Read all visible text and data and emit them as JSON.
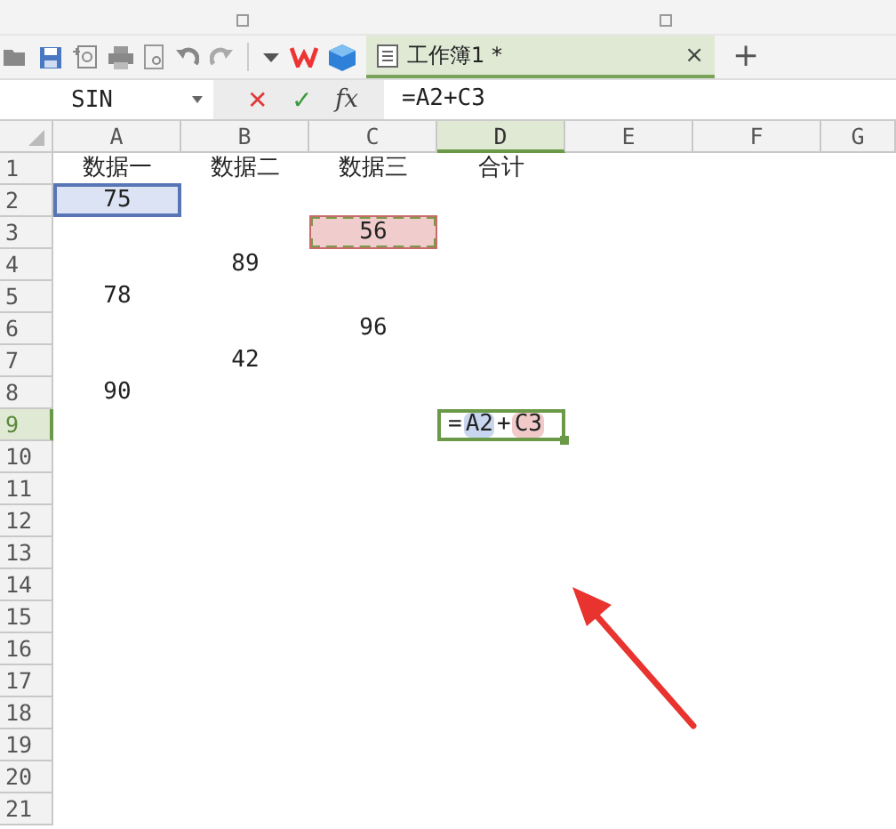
{
  "toolbar": {
    "tab": {
      "title": "工作簿1 *",
      "selected": true,
      "close": "×",
      "new": "+"
    }
  },
  "formula_bar": {
    "name_box": "SIN",
    "cancel": "✕",
    "confirm": "✓",
    "fx": "fx",
    "formula": "=A2+C3"
  },
  "columns": [
    {
      "label": "A",
      "selected": false
    },
    {
      "label": "B",
      "selected": false
    },
    {
      "label": "C",
      "selected": false
    },
    {
      "label": "D",
      "selected": true
    },
    {
      "label": "E",
      "selected": false
    },
    {
      "label": "F",
      "selected": false
    },
    {
      "label": "G",
      "selected": false
    }
  ],
  "rows": [
    {
      "number": "1",
      "selected": false,
      "cells": [
        {
          "text": "数据一"
        },
        {
          "text": "数据二"
        },
        {
          "text": "数据三"
        },
        {
          "text": "合计"
        },
        null,
        null,
        null
      ]
    },
    {
      "number": "2",
      "selected": false,
      "cells": [
        {
          "text": "75",
          "kind": "solid",
          "color": "#dbe3f4"
        },
        null,
        null,
        null,
        null,
        null,
        null
      ]
    },
    {
      "number": "3",
      "selected": false,
      "cells": [
        null,
        null,
        {
          "text": "56",
          "kind": "dashed",
          "color": "#f0cccc"
        },
        null,
        null,
        null,
        null
      ]
    },
    {
      "number": "4",
      "selected": false,
      "cells": [
        null,
        {
          "text": "89"
        },
        null,
        null,
        null,
        null,
        null
      ]
    },
    {
      "number": "5",
      "selected": false,
      "cells": [
        {
          "text": "78"
        },
        null,
        null,
        null,
        null,
        null,
        null
      ]
    },
    {
      "number": "6",
      "selected": false,
      "cells": [
        null,
        null,
        {
          "text": "96"
        },
        null,
        null,
        null,
        null
      ]
    },
    {
      "number": "7",
      "selected": false,
      "cells": [
        null,
        {
          "text": "42"
        },
        null,
        null,
        null,
        null,
        null
      ]
    },
    {
      "number": "8",
      "selected": false,
      "cells": [
        {
          "text": "90"
        },
        null,
        null,
        null,
        null,
        null,
        null
      ]
    },
    {
      "number": "9",
      "selected": true,
      "cells": [
        null,
        null,
        null,
        {
          "kind": "editing",
          "parts": [
            {
              "text": "="
            },
            {
              "text": "A2",
              "color": "#c9d6f0"
            },
            {
              "text": "+"
            },
            {
              "text": "C3",
              "color": "#f2c9c9"
            }
          ]
        },
        null,
        null,
        null
      ]
    },
    {
      "number": "10",
      "selected": false,
      "cells": [
        null,
        null,
        null,
        null,
        null,
        null,
        null
      ]
    },
    {
      "number": "11",
      "selected": false,
      "cells": [
        null,
        null,
        null,
        null,
        null,
        null,
        null
      ]
    },
    {
      "number": "12",
      "selected": false,
      "cells": [
        null,
        null,
        null,
        null,
        null,
        null,
        null
      ]
    },
    {
      "number": "13",
      "selected": false,
      "cells": [
        null,
        null,
        null,
        null,
        null,
        null,
        null
      ]
    },
    {
      "number": "14",
      "selected": false,
      "cells": [
        null,
        null,
        null,
        null,
        null,
        null,
        null
      ]
    },
    {
      "number": "15",
      "selected": false,
      "cells": [
        null,
        null,
        null,
        null,
        null,
        null,
        null
      ]
    },
    {
      "number": "16",
      "selected": false,
      "cells": [
        null,
        null,
        null,
        null,
        null,
        null,
        null
      ]
    },
    {
      "number": "17",
      "selected": false,
      "cells": [
        null,
        null,
        null,
        null,
        null,
        null,
        null
      ]
    },
    {
      "number": "18",
      "selected": false,
      "cells": [
        null,
        null,
        null,
        null,
        null,
        null,
        null
      ]
    },
    {
      "number": "19",
      "selected": false,
      "cells": [
        null,
        null,
        null,
        null,
        null,
        null,
        null
      ]
    },
    {
      "number": "20",
      "selected": false,
      "cells": [
        null,
        null,
        null,
        null,
        null,
        null,
        null
      ]
    },
    {
      "number": "21",
      "selected": false,
      "cells": [
        null,
        null,
        null,
        null,
        null,
        null,
        null
      ]
    }
  ]
}
